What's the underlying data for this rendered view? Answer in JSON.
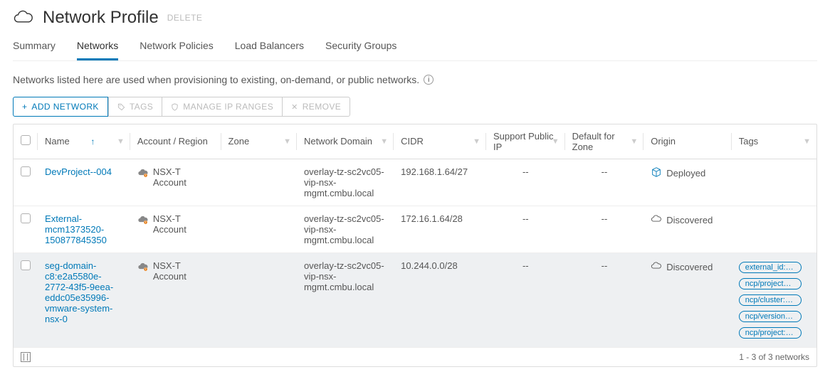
{
  "header": {
    "title": "Network Profile",
    "delete_label": "DELETE"
  },
  "tabs": [
    {
      "label": "Summary"
    },
    {
      "label": "Networks",
      "active": true
    },
    {
      "label": "Network Policies"
    },
    {
      "label": "Load Balancers"
    },
    {
      "label": "Security Groups"
    }
  ],
  "description": "Networks listed here are used when provisioning to existing, on-demand, or public networks.",
  "toolbar": {
    "add_label": "ADD NETWORK",
    "tags_label": "TAGS",
    "manage_ip_label": "MANAGE IP RANGES",
    "remove_label": "REMOVE"
  },
  "columns": {
    "name": "Name",
    "account": "Account / Region",
    "zone": "Zone",
    "domain": "Network Domain",
    "cidr": "CIDR",
    "pubip": "Support Public IP",
    "defzone": "Default for Zone",
    "origin": "Origin",
    "tags": "Tags"
  },
  "rows": [
    {
      "name": "DevProject--004",
      "account": "NSX-T Account",
      "zone": "",
      "domain": "overlay-tz-sc2vc05-vip-nsx-mgmt.cmbu.local",
      "cidr": "192.168.1.64/27",
      "pubip": "--",
      "defzone": "--",
      "origin": "Deployed",
      "origin_kind": "deployed",
      "tags": []
    },
    {
      "name": "External-mcm1373520-150877845350",
      "account": "NSX-T Account",
      "zone": "",
      "domain": "overlay-tz-sc2vc05-vip-nsx-mgmt.cmbu.local",
      "cidr": "172.16.1.64/28",
      "pubip": "--",
      "defzone": "--",
      "origin": "Discovered",
      "origin_kind": "discovered",
      "tags": []
    },
    {
      "name": "seg-domain-c8:e2a5580e-2772-43f5-9eea-eddc05e35996-vmware-system-nsx-0",
      "account": "NSX-T Account",
      "zone": "",
      "domain": "overlay-tz-sc2vc05-vip-nsx-mgmt.cmbu.local",
      "cidr": "10.244.0.0/28",
      "pubip": "--",
      "defzone": "--",
      "origin": "Discovered",
      "origin_kind": "discovered",
      "selected": true,
      "tags": [
        "external_id:8...",
        "ncp/project_u...",
        "ncp/cluster:d...",
        "ncp/version:1....",
        "ncp/project:v..."
      ]
    }
  ],
  "footer": {
    "pagination": "1 - 3 of 3 networks"
  }
}
